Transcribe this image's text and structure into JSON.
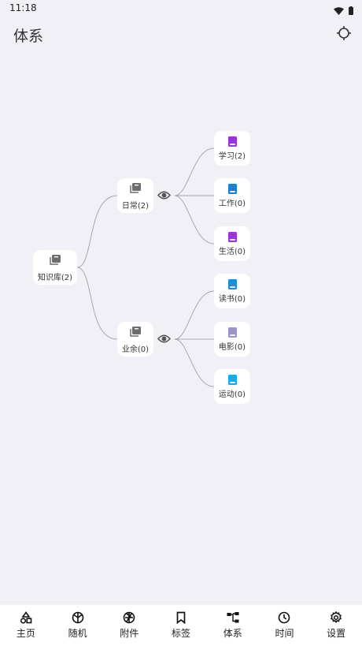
{
  "status": {
    "time": "11:18"
  },
  "header": {
    "title": "体系"
  },
  "tree": {
    "root": {
      "label": "知识库(2)",
      "icon": "library-icon"
    },
    "categories": [
      {
        "label": "日常(2)",
        "icon": "library-icon"
      },
      {
        "label": "业余(0)",
        "icon": "library-icon"
      }
    ],
    "notebooks": [
      {
        "label": "学习(2)",
        "color": "#9a34d8"
      },
      {
        "label": "工作(0)",
        "color": "#1f80c8"
      },
      {
        "label": "生活(0)",
        "color": "#9a34d8"
      },
      {
        "label": "读书(0)",
        "color": "#1c8fd6"
      },
      {
        "label": "电影(0)",
        "color": "#9c94c8"
      },
      {
        "label": "运动(0)",
        "color": "#1aaae6"
      }
    ]
  },
  "nav": [
    {
      "label": "主页",
      "icon": "shapes-icon"
    },
    {
      "label": "随机",
      "icon": "dice-icon"
    },
    {
      "label": "附件",
      "icon": "aperture-icon"
    },
    {
      "label": "标签",
      "icon": "bookmark-icon"
    },
    {
      "label": "体系",
      "icon": "hierarchy-icon"
    },
    {
      "label": "时间",
      "icon": "clock-icon"
    },
    {
      "label": "设置",
      "icon": "gear-icon"
    }
  ]
}
